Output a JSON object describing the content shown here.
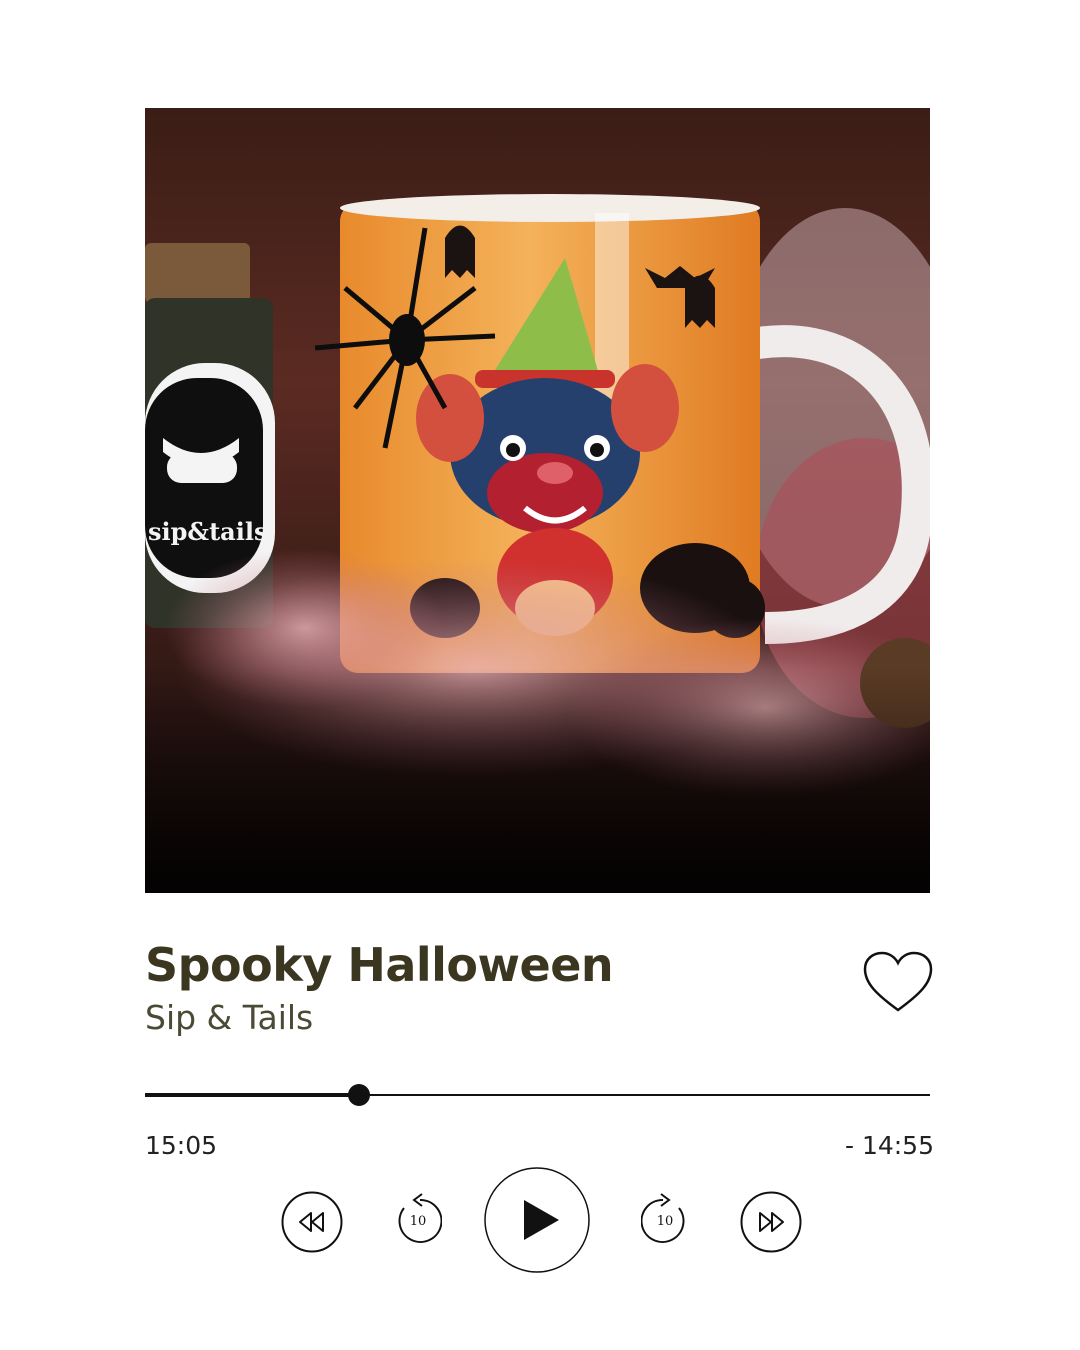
{
  "track": {
    "title": "Spooky Halloween",
    "artist": "Sip & Tails"
  },
  "artwork": {
    "jar_label": "sip&tails",
    "icon": "halloween-mug-photo"
  },
  "playback": {
    "elapsed": "15:05",
    "remaining": "- 14:55",
    "progress_fraction": 0.272
  },
  "controls": {
    "rewind_icon": "rewind-icon",
    "skip_back_seconds": "10",
    "play_icon": "play-icon",
    "skip_forward_seconds": "10",
    "fast_forward_icon": "fast-forward-icon",
    "like_icon": "heart-outline-icon"
  },
  "colors": {
    "title": "#3a3620",
    "artist": "#4b4a34",
    "controls": "#111111",
    "background": "#ffffff"
  }
}
